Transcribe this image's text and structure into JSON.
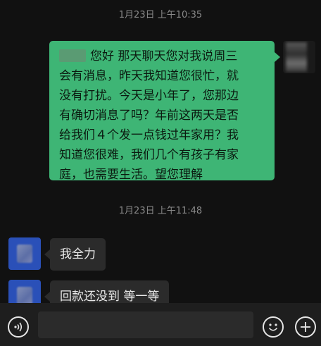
{
  "timestamps": [
    "1月23日 上午10:35",
    "1月23日 上午11:48"
  ],
  "messages": [
    {
      "sender": "me",
      "lines": [
        "您好  那天聊天您对我说周三",
        "会有消息，昨天我知道您很忙，就",
        "没有打扰。今天是小年了，您那边",
        "有确切消息了吗？年前这两天是否",
        "给我们４个发一点钱过年家用？我",
        "知道您很难，我们几个有孩子有家",
        "庭，也需要生活。望您理解"
      ]
    },
    {
      "sender": "them",
      "text": "我全力"
    },
    {
      "sender": "them",
      "text": "回款还没到 等一等"
    }
  ],
  "input": {
    "placeholder": ""
  },
  "icons": {
    "voice": "voice-icon",
    "emoji": "emoji-icon",
    "add": "add-icon"
  },
  "colors": {
    "background": "#111111",
    "my_bubble": "#3eb575",
    "their_bubble": "#2b2b2b",
    "input_bar": "#1e1e1e"
  }
}
